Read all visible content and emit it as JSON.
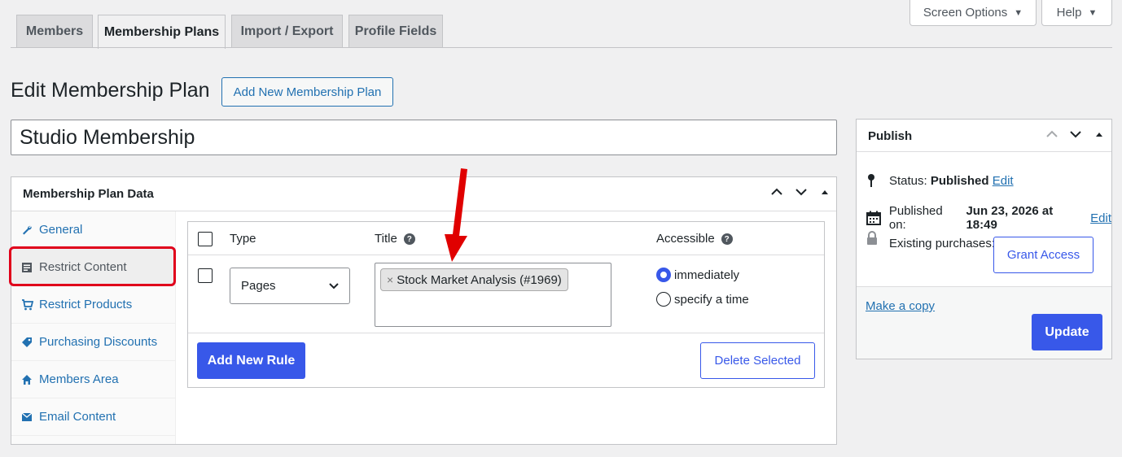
{
  "tabs": [
    "Members",
    "Membership Plans",
    "Import / Export",
    "Profile Fields"
  ],
  "active_tab": "Membership Plans",
  "screen_options": {
    "label": "Screen Options",
    "caret": "▼"
  },
  "help": {
    "label": "Help",
    "caret": "▼"
  },
  "heading": "Edit Membership Plan",
  "add_new_button": "Add New Membership Plan",
  "plan_title": "Studio Membership",
  "plan_data": {
    "title": "Membership Plan Data",
    "nav": [
      {
        "label": "General",
        "icon": "wrench-icon"
      },
      {
        "label": "Restrict Content",
        "icon": "post-content-icon"
      },
      {
        "label": "Restrict Products",
        "icon": "cart-icon"
      },
      {
        "label": "Purchasing Discounts",
        "icon": "tag-icon"
      },
      {
        "label": "Members Area",
        "icon": "home-icon"
      },
      {
        "label": "Email Content",
        "icon": "email-icon"
      }
    ],
    "active_nav": "Restrict Content",
    "rules_table": {
      "headers": {
        "type": "Type",
        "title": "Title",
        "accessible": "Accessible"
      },
      "help_glyph": "?",
      "rows": [
        {
          "type": "Pages",
          "title_chips": [
            {
              "remove": "×",
              "label": "Stock Market Analysis (#1969)"
            }
          ],
          "accessible_options": [
            "immediately",
            "specify a time"
          ],
          "accessible_selected": "immediately"
        }
      ]
    },
    "add_rule_button": "Add New Rule",
    "delete_selected_button": "Delete Selected"
  },
  "publish": {
    "title": "Publish",
    "status_label": "Status:",
    "status_value": "Published",
    "status_edit": "Edit",
    "published_label": "Published on:",
    "published_value": "Jun 23, 2026 at 18:49",
    "published_edit": "Edit",
    "purchases_label": "Existing purchases:",
    "grant_access_button": "Grant Access",
    "make_copy": "Make a copy",
    "update_button": "Update"
  },
  "colors": {
    "accent": "#3858e9",
    "link": "#2271b1",
    "highlight": "#e0001b",
    "background": "#f0f0f1"
  }
}
